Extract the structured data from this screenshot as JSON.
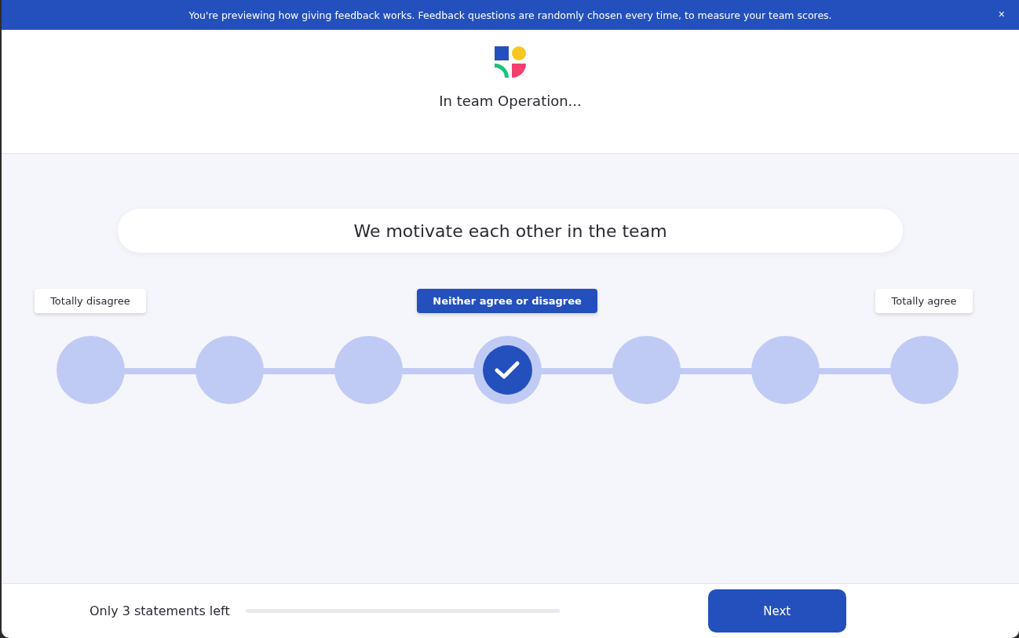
{
  "banner": {
    "text": "You're previewing how giving feedback works. Feedback questions are randomly chosen every time, to measure your team scores.",
    "close": "×"
  },
  "header": {
    "title": "In team Operation..."
  },
  "statement": "We motivate each other in the team",
  "options": [
    {
      "label": "Totally disagree",
      "selected": false
    },
    {
      "selected": false
    },
    {
      "selected": false
    },
    {
      "label": "Neither agree or disagree",
      "selected": true
    },
    {
      "selected": false
    },
    {
      "selected": false
    },
    {
      "label": "Totally agree",
      "selected": false
    }
  ],
  "footer": {
    "remaining": "Only 3 statements left",
    "progress": {
      "level": 0
    },
    "next": "Next"
  }
}
